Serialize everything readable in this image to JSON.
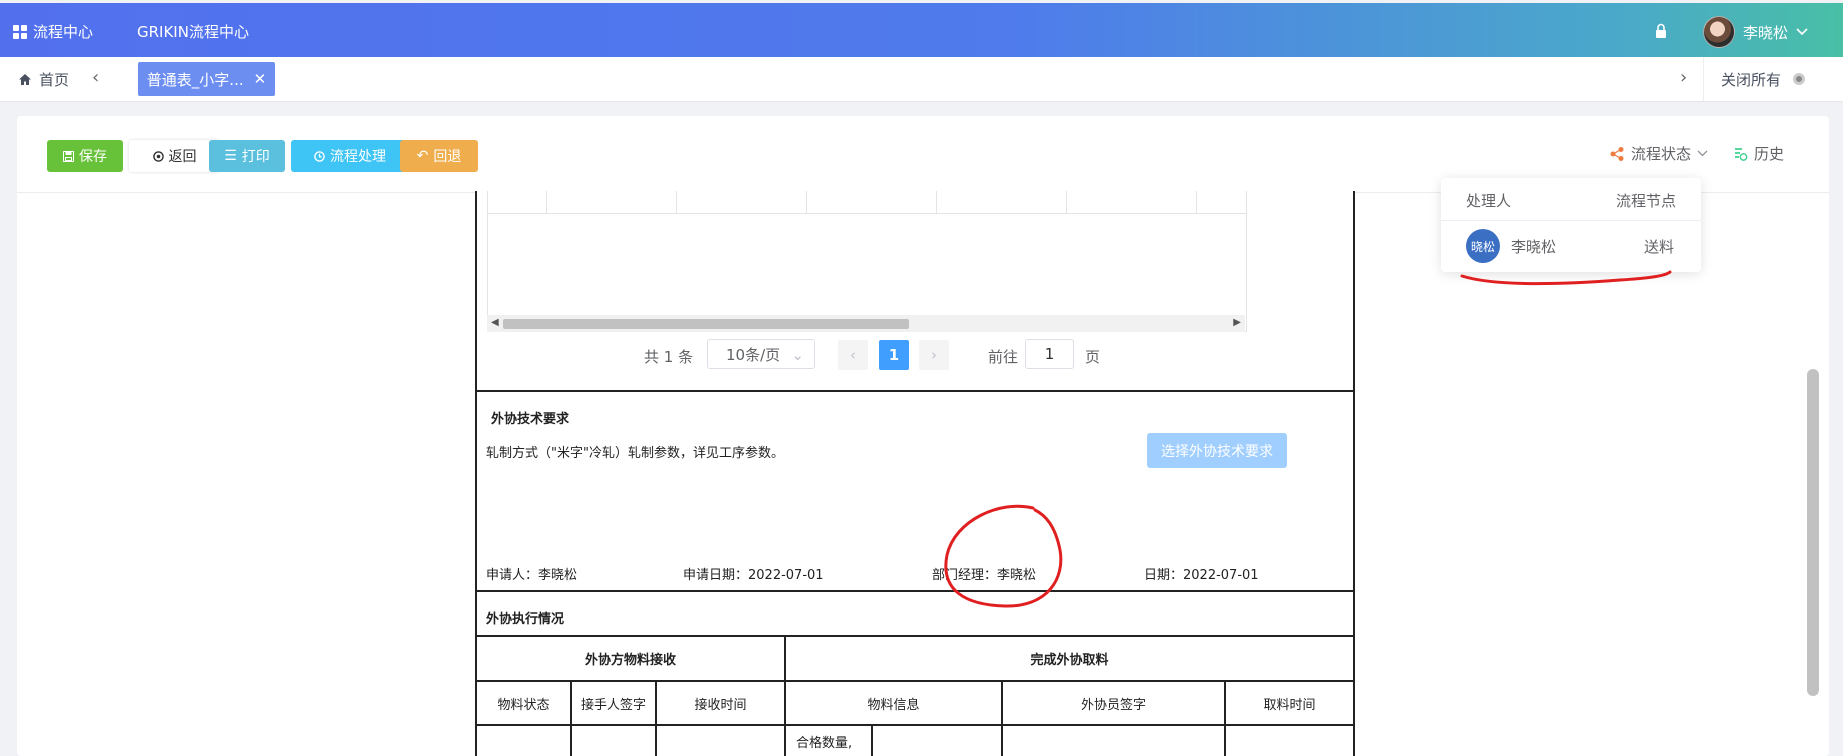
{
  "topbar": {
    "menu_label": "流程中心",
    "system_name": "GRIKIN流程中心",
    "user_name": "李晓松"
  },
  "tabs": {
    "home_label": "首页",
    "active_tab": "普通表_小字...",
    "close_all": "关闭所有"
  },
  "toolbar": {
    "save": "保存",
    "back": "返回",
    "print": "打印",
    "process": "流程处理",
    "return": "回退",
    "flow_status": "流程状态",
    "history": "历史"
  },
  "popover": {
    "col_handler": "处理人",
    "col_node": "流程节点",
    "avatar_text": "晓松",
    "handler_name": "李晓松",
    "node": "送料"
  },
  "pagination": {
    "total": "共 1 条",
    "page_size": "10条/页",
    "current_page": "1",
    "goto_label": "前往",
    "goto_value": "1",
    "page_suffix": "页"
  },
  "outsource_tech": {
    "section_title": "外协技术要求",
    "content": "轧制方式（\"米字\"冷轧）轧制参数，详见工序参数。",
    "select_button": "选择外协技术要求",
    "applicant": "申请人：李晓松",
    "apply_date": "申请日期：2022-07-01",
    "dept_manager": "部门经理：李晓松",
    "date": "日期：2022-07-01"
  },
  "execution": {
    "section_title": "外协执行情况",
    "group_receive": "外协方物料接收",
    "group_complete": "完成外协取料",
    "columns": [
      "物料状态",
      "接手人签字",
      "接收时间",
      "物料信息",
      "外协员签字",
      "取料时间"
    ],
    "partial_cell": "合格数量,"
  }
}
